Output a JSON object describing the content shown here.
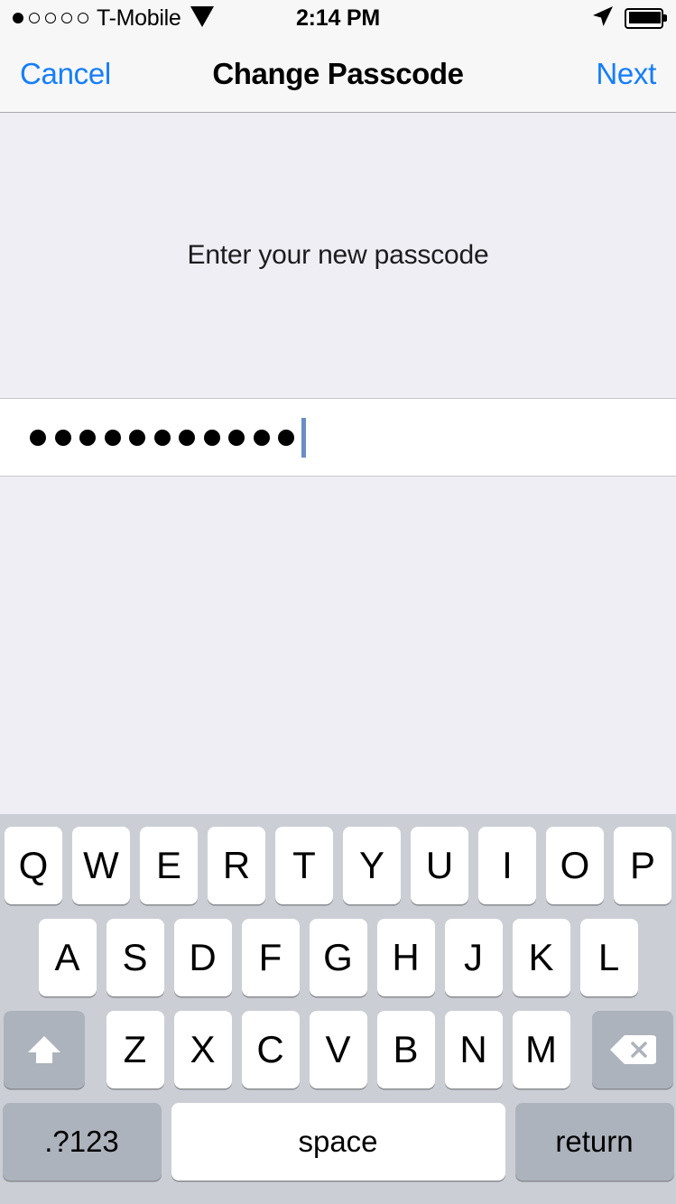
{
  "status_bar": {
    "signal_dots_total": 5,
    "signal_dots_filled": 1,
    "carrier": "T-Mobile",
    "wifi_icon": "wifi-icon",
    "time": "2:14 PM",
    "location_icon": "location-arrow-icon",
    "battery_icon": "battery-full-icon",
    "battery_level_percent": 100
  },
  "nav_bar": {
    "cancel_label": "Cancel",
    "title": "Change Passcode",
    "next_label": "Next",
    "tint_color": "#157EFB"
  },
  "content": {
    "prompt": "Enter your new passcode",
    "passcode_dot_count": 11,
    "caret_color": "#6C8CC6",
    "background_color": "#EFEEF4",
    "field_background_color": "#FFFFFF"
  },
  "keyboard": {
    "background_color": "#CBCFD5",
    "key_color": "#FFFFFF",
    "modifier_key_color": "#ADB3BC",
    "row1": [
      "Q",
      "W",
      "E",
      "R",
      "T",
      "Y",
      "U",
      "I",
      "O",
      "P"
    ],
    "row2": [
      "A",
      "S",
      "D",
      "F",
      "G",
      "H",
      "J",
      "K",
      "L"
    ],
    "row3": [
      "Z",
      "X",
      "C",
      "V",
      "B",
      "N",
      "M"
    ],
    "shift_icon": "shift-icon",
    "delete_icon": "delete-backspace-icon",
    "numbers_label": ".?123",
    "space_label": "space",
    "return_label": "return"
  }
}
